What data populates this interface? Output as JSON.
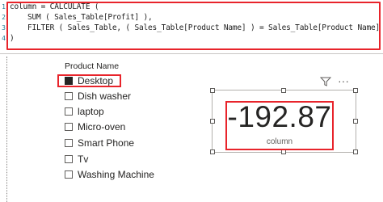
{
  "editor": {
    "lines": [
      {
        "num": "1",
        "code": "column = CALCULATE ("
      },
      {
        "num": "2",
        "code": "SUM ( Sales_Table[Profit] ),"
      },
      {
        "num": "3",
        "code": "FILTER ( Sales_Table, ( Sales_Table[Product Name] ) = Sales_Table[Product Name] )"
      },
      {
        "num": "4",
        "code": ")"
      }
    ]
  },
  "slicer": {
    "title": "Product Name",
    "items": [
      {
        "label": "Desktop",
        "checked": true
      },
      {
        "label": "Dish washer",
        "checked": false
      },
      {
        "label": "laptop",
        "checked": false
      },
      {
        "label": "Micro-oven",
        "checked": false
      },
      {
        "label": "Smart Phone",
        "checked": false
      },
      {
        "label": "Tv",
        "checked": false
      },
      {
        "label": "Washing Machine",
        "checked": false
      }
    ]
  },
  "card": {
    "value": "-192.87",
    "label": "column",
    "more_glyph": "···"
  },
  "colors": {
    "highlight": "#e8242b",
    "text": "#252423"
  }
}
